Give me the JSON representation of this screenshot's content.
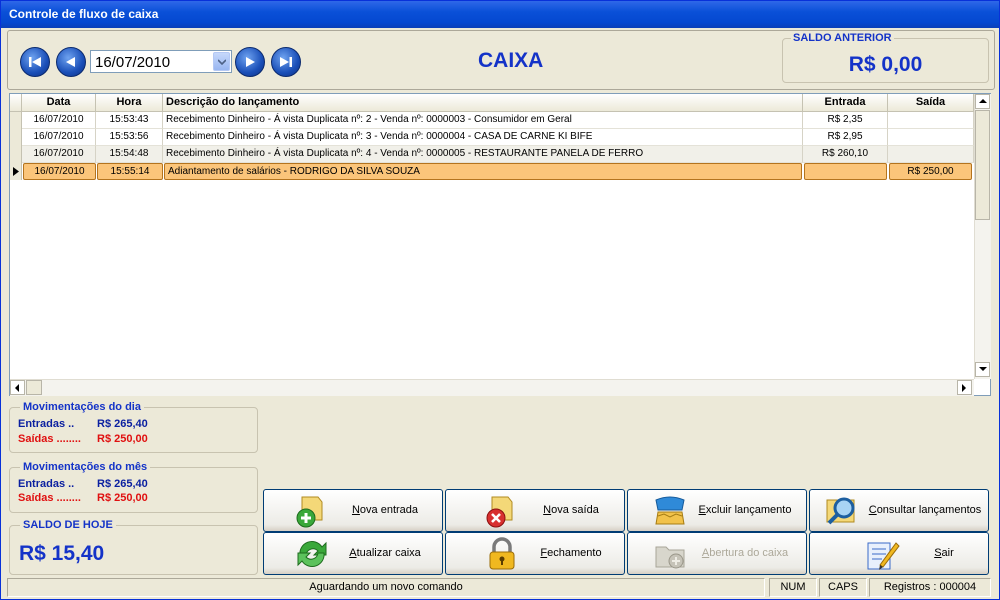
{
  "window": {
    "title": "Controle de fluxo de caixa"
  },
  "nav": {
    "first_icon": "first-record-icon",
    "prev_icon": "previous-record-icon",
    "next_icon": "next-record-icon",
    "last_icon": "last-record-icon",
    "date_value": "16/07/2010"
  },
  "header": {
    "title": "CAIXA",
    "saldo_anterior_label": "SALDO ANTERIOR",
    "saldo_anterior_value": "R$ 0,00"
  },
  "grid": {
    "columns": [
      "Data",
      "Hora",
      "Descrição do lançamento",
      "Entrada",
      "Saída"
    ],
    "rows": [
      {
        "data": "16/07/2010",
        "hora": "15:53:43",
        "desc": "Recebimento Dinheiro - Á vista Duplicata nº: 2 - Venda nº: 0000003 - Consumidor em Geral",
        "entrada": "R$ 2,35",
        "saida": ""
      },
      {
        "data": "16/07/2010",
        "hora": "15:53:56",
        "desc": "Recebimento Dinheiro - Á vista Duplicata nº: 3 - Venda nº: 0000004 - CASA DE CARNE KI BIFE",
        "entrada": "R$ 2,95",
        "saida": ""
      },
      {
        "data": "16/07/2010",
        "hora": "15:54:48",
        "desc": "Recebimento Dinheiro - Á vista Duplicata nº: 4 - Venda nº: 0000005 - RESTAURANTE PANELA DE FERRO",
        "entrada": "R$ 260,10",
        "saida": ""
      },
      {
        "data": "16/07/2010",
        "hora": "15:55:14",
        "desc": "Adiantamento de salários - RODRIGO DA SILVA SOUZA",
        "entrada": "",
        "saida": "R$ 250,00"
      }
    ]
  },
  "mov_dia": {
    "title": "Movimentações do dia",
    "entradas_label": "Entradas ..",
    "entradas_value": "R$ 265,40",
    "saidas_label": "Saídas ........",
    "saidas_value": "R$ 250,00"
  },
  "mov_mes": {
    "title": "Movimentações do mês",
    "entradas_label": "Entradas ..",
    "entradas_value": "R$ 265,40",
    "saidas_label": "Saídas ........",
    "saidas_value": "R$ 250,00"
  },
  "saldo_hoje": {
    "title": "SALDO DE HOJE",
    "value": "R$ 15,40"
  },
  "actions": {
    "nova_entrada": "Nova entrada",
    "nova_saida": "Nova saída",
    "excluir": "Excluir lançamento",
    "consultar": "Consultar lançamentos",
    "atualizar": "Atualizar caixa",
    "fechamento": "Fechamento",
    "abertura": "Abertura do caixa",
    "sair": "Sair"
  },
  "status": {
    "message": "Aguardando um novo comando",
    "num": "NUM",
    "caps": "CAPS",
    "registros": "Registros : 000004"
  },
  "colors": {
    "accent_blue": "#1433c8",
    "selected_row": "#fbc57a",
    "negative_red": "#e01010"
  }
}
